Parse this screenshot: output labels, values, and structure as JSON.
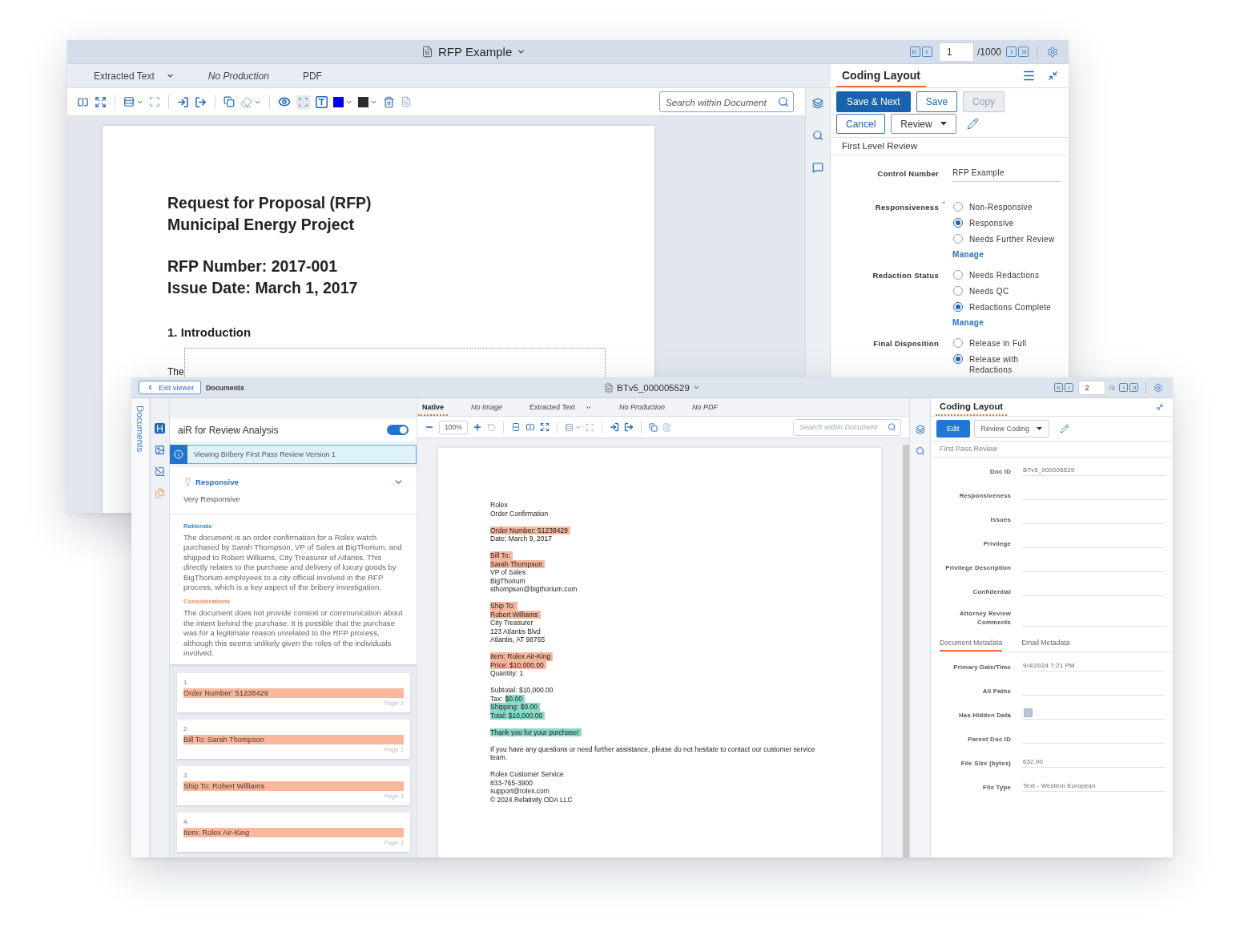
{
  "back_window": {
    "title": "RFP Example",
    "pager": {
      "page": "1",
      "total": "/1000"
    },
    "viewer_tabs": [
      {
        "label": "Extracted Text",
        "selected": false,
        "available": true,
        "dropdown": true
      },
      {
        "label": "No Production",
        "selected": false,
        "available": false,
        "dropdown": false
      },
      {
        "label": "PDF",
        "selected": false,
        "available": true,
        "dropdown": false
      }
    ],
    "search": {
      "placeholder": "Search within Document"
    },
    "document": {
      "heading": [
        "Request for Proposal (RFP)",
        "Municipal Energy Project"
      ],
      "details": [
        "RFP Number: 2017-001",
        "Issue Date: March 1, 2017"
      ],
      "section": "1. Introduction",
      "body": "The"
    },
    "coding": {
      "title": "Coding Layout",
      "button_rows": [
        [
          {
            "label": "Save & Next",
            "kind": "primary",
            "disabled": false
          },
          {
            "label": "Save",
            "kind": "outline",
            "disabled": false
          },
          {
            "label": "Copy",
            "kind": "outline",
            "disabled": true
          }
        ],
        [
          {
            "label": "Cancel",
            "kind": "outline",
            "disabled": false
          },
          {
            "label": "Review",
            "kind": "dropdown",
            "disabled": false
          }
        ]
      ],
      "layout_name": "First Level Review",
      "fields": [
        {
          "kind": "text",
          "label": "Control Number",
          "value": "RFP Example"
        },
        {
          "kind": "radio",
          "label": "Responsiveness",
          "required_mark": "*",
          "options": [
            {
              "label": "Non-Responsive",
              "selected": false
            },
            {
              "label": "Responsive",
              "selected": true
            },
            {
              "label": "Needs Further Review",
              "selected": false
            }
          ],
          "link": "Manage"
        },
        {
          "kind": "radio",
          "label": "Redaction Status",
          "options": [
            {
              "label": "Needs Redactions",
              "selected": false
            },
            {
              "label": "Needs QC",
              "selected": false
            },
            {
              "label": "Redactions Complete",
              "selected": true
            }
          ],
          "link": "Manage"
        },
        {
          "kind": "radio",
          "label": "Final Disposition",
          "options": [
            {
              "label": "Release in Full",
              "selected": false
            },
            {
              "label": "Release with Redactions",
              "selected": true
            }
          ]
        }
      ]
    }
  },
  "front_window": {
    "exit_button": "Exit viewer",
    "breadcrumb": "Documents",
    "title": "BTv5_000005529",
    "pager": {
      "page": "2",
      "total": "/9"
    },
    "side_tab": "Documents",
    "air_panel": {
      "title": "aiR for Review Analysis",
      "enabled": true,
      "banner": "Viewing Bribery First Pass Review Version 1",
      "result": {
        "label": "Responsive",
        "detail": "Very Responsive"
      },
      "sections": [
        {
          "kind": "rationale",
          "heading": "Rationale",
          "text": "The document is an order confirmation for a Rolex watch purchased by Sarah Thompson, VP of Sales at BigThorium, and shipped to Robert Williams, City Treasurer of Atlantis. This directly relates to the purchase and delivery of luxury goods by BigThorium employees to a city official involved in the RFP process, which is a key aspect of the bribery investigation."
        },
        {
          "kind": "considerations",
          "heading": "Considerations",
          "text": "The document does not provide context or communication about the intent behind the purchase. It is possible that the purchase was for a legitimate reason unrelated to the RFP process, although this seems unlikely given the roles of the individuals involved."
        }
      ],
      "citations": [
        {
          "number": "1.",
          "text": "Order Number: 51238429",
          "page": "Page 1"
        },
        {
          "number": "2.",
          "text": "Bill To: Sarah Thompson",
          "page": "Page 1"
        },
        {
          "number": "3.",
          "text": "Ship To: Robert Williams",
          "page": "Page 1"
        },
        {
          "number": "4.",
          "text": "Item: Rolex Air-King",
          "page": "Page 1"
        }
      ]
    },
    "viewer_tabs": [
      {
        "label": "Native",
        "selected": true,
        "available": true,
        "dropdown": false
      },
      {
        "label": "No Image",
        "selected": false,
        "available": false,
        "dropdown": false
      },
      {
        "label": "Extracted Text",
        "selected": false,
        "available": true,
        "dropdown": true
      },
      {
        "label": "No Production",
        "selected": false,
        "available": false,
        "dropdown": false
      },
      {
        "label": "No PDF",
        "selected": false,
        "available": false,
        "dropdown": false
      }
    ],
    "zoom": "100%",
    "search": {
      "placeholder": "Search within Document"
    },
    "document": {
      "paragraphs": [
        {
          "lines": [
            [
              {
                "text": "Rolex",
                "kind": "plain"
              }
            ],
            [
              {
                "text": "Order Confirmation",
                "kind": "plain"
              }
            ]
          ]
        },
        {
          "lines": [
            [
              {
                "text": "Order Number: 51238429",
                "kind": "citation"
              }
            ],
            [
              {
                "text": "Date: March 9, 2017",
                "kind": "plain"
              }
            ]
          ]
        },
        {
          "lines": [
            [
              {
                "text": "Bill To:",
                "kind": "citation"
              }
            ],
            [
              {
                "text": "Sarah Thompson",
                "kind": "citation"
              }
            ],
            [
              {
                "text": "VP of Sales",
                "kind": "plain"
              }
            ],
            [
              {
                "text": "BigThorium",
                "kind": "plain"
              }
            ],
            [
              {
                "text": "sthompson@bigthorium.com",
                "kind": "plain"
              }
            ]
          ]
        },
        {
          "lines": [
            [
              {
                "text": "Ship To:",
                "kind": "citation"
              }
            ],
            [
              {
                "text": "Robert Williams",
                "kind": "citation"
              }
            ],
            [
              {
                "text": "City Treasurer",
                "kind": "plain"
              }
            ],
            [
              {
                "text": "123 Atlantis Blvd",
                "kind": "plain"
              }
            ],
            [
              {
                "text": "Atlantis, AT 98765",
                "kind": "plain"
              }
            ]
          ]
        },
        {
          "lines": [
            [
              {
                "text": "Item: Rolex Air-King",
                "kind": "citation"
              }
            ],
            [
              {
                "text": "Price: $10,000.00",
                "kind": "citation"
              }
            ],
            [
              {
                "text": "Quantity: 1",
                "kind": "plain"
              }
            ]
          ]
        },
        {
          "lines": [
            [
              {
                "text": "Subtotal: $10,000.00",
                "kind": "plain"
              }
            ],
            [
              {
                "text": "Tax:",
                "kind": "plain"
              },
              {
                "text": "$0.00",
                "kind": "match"
              }
            ],
            [
              {
                "text": "Shipping: $0.00",
                "kind": "match"
              }
            ],
            [
              {
                "text": "Total: $10,000.00",
                "kind": "match"
              }
            ]
          ]
        },
        {
          "lines": [
            [
              {
                "text": "Thank you for your purchase!",
                "kind": "match"
              }
            ]
          ]
        },
        {
          "lines": [
            [
              {
                "text": "If you have any questions or need further assistance, please do not hesitate to contact our customer service team.",
                "kind": "plain"
              }
            ]
          ]
        },
        {
          "lines": [
            [
              {
                "text": "Rolex Customer Service",
                "kind": "plain"
              }
            ],
            [
              {
                "text": "833-765-3900",
                "kind": "plain"
              }
            ],
            [
              {
                "text": "support@rolex.com",
                "kind": "plain"
              }
            ],
            [
              {
                "text": "© 2024 Relativity ODA LLC",
                "kind": "plain"
              }
            ]
          ]
        }
      ]
    },
    "coding": {
      "title": "Coding Layout",
      "buttons": [
        {
          "label": "Edit",
          "kind": "primary",
          "disabled": false
        },
        {
          "label": "Review Coding",
          "kind": "dropdown",
          "disabled": false
        }
      ],
      "layout_name": "First Pass Review",
      "fields": [
        {
          "label": "Doc ID",
          "value": "BTv5_000005529"
        },
        {
          "label": "Responsiveness"
        },
        {
          "label": "Issues"
        },
        {
          "label": "Privilege"
        },
        {
          "label": "Privilege Description"
        },
        {
          "label": "Confidential"
        },
        {
          "label": "Attorney Review Comments"
        }
      ],
      "metadata_tabs": [
        {
          "label": "Document Metadata",
          "selected": true
        },
        {
          "label": "Email Metadata",
          "selected": false
        }
      ],
      "metadata": [
        {
          "kind": "text",
          "label": "Primary Date/Time",
          "value": "9/4/2024 7:21 PM"
        },
        {
          "kind": "text",
          "label": "All Paths"
        },
        {
          "kind": "checkbox",
          "label": "Has Hidden Data",
          "checked": false
        },
        {
          "kind": "text",
          "label": "Parent Doc ID"
        },
        {
          "kind": "text",
          "label": "File Size (bytes)",
          "value": "632.00"
        },
        {
          "kind": "text",
          "label": "File Type",
          "value": "Text - Western European"
        }
      ]
    }
  }
}
